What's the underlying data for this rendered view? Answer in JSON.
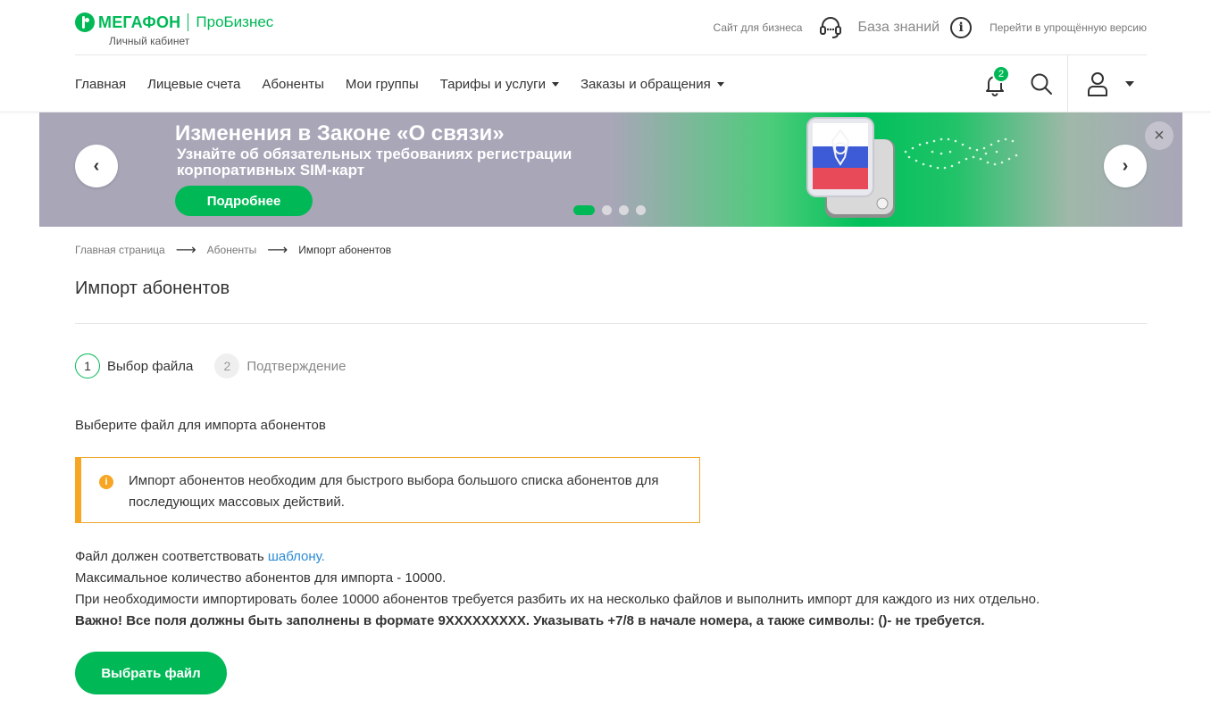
{
  "header": {
    "logo_name": "МЕГАФОН",
    "logo_product": "ПроБизнес",
    "logo_sub": "Личный кабинет",
    "site_for_business": "Сайт для бизнеса",
    "knowledge_base": "База знаний",
    "info_icon_glyph": "i",
    "simple_version": "Перейти в упрощённую версию"
  },
  "nav": {
    "items": [
      {
        "label": "Главная"
      },
      {
        "label": "Лицевые счета"
      },
      {
        "label": "Абоненты"
      },
      {
        "label": "Мои группы"
      },
      {
        "label": "Тарифы и услуги"
      },
      {
        "label": "Заказы и обращения"
      }
    ],
    "notifications_count": "2"
  },
  "banner": {
    "title": "Изменения в Законе «О связи»",
    "subtitle": "Узнайте об обязательных требованиях регистрации корпоративных SIM-карт",
    "button": "Подробнее",
    "prev_glyph": "‹",
    "next_glyph": "›",
    "close_glyph": "×",
    "slides_total": 4,
    "slide_active": 1
  },
  "breadcrumb": {
    "items": [
      "Главная страница",
      "Абоненты",
      "Импорт абонентов"
    ],
    "separator": "⟶"
  },
  "page": {
    "title": "Импорт абонентов",
    "steps": [
      {
        "number": "1",
        "label": "Выбор файла"
      },
      {
        "number": "2",
        "label": "Подтверждение"
      }
    ],
    "section_title": "Выберите файл для импорта абонентов",
    "notice_icon_glyph": "i",
    "notice": "Импорт абонентов необходим для быстрого выбора большого списка абонентов для последующих массовых действий.",
    "rule_1_prefix": "Файл должен соответствовать ",
    "rule_1_link": "шаблону.",
    "rule_2": "Максимальное количество абонентов для импорта - 10000.",
    "rule_3": "При необходимости импортировать более 10000 абонентов требуется разбить их на несколько файлов и выполнить импорт для каждого из них отдельно.",
    "rule_4": "Важно! Все поля должны быть заполнены в формате 9ХХХХХХХХХ. Указывать +7/8 в начале номера, а также символы: ()- не требуется.",
    "choose_button": "Выбрать файл"
  },
  "colors": {
    "brand_green": "#00b956",
    "notice_orange": "#f6a623",
    "link_blue": "#2a8ad6"
  }
}
